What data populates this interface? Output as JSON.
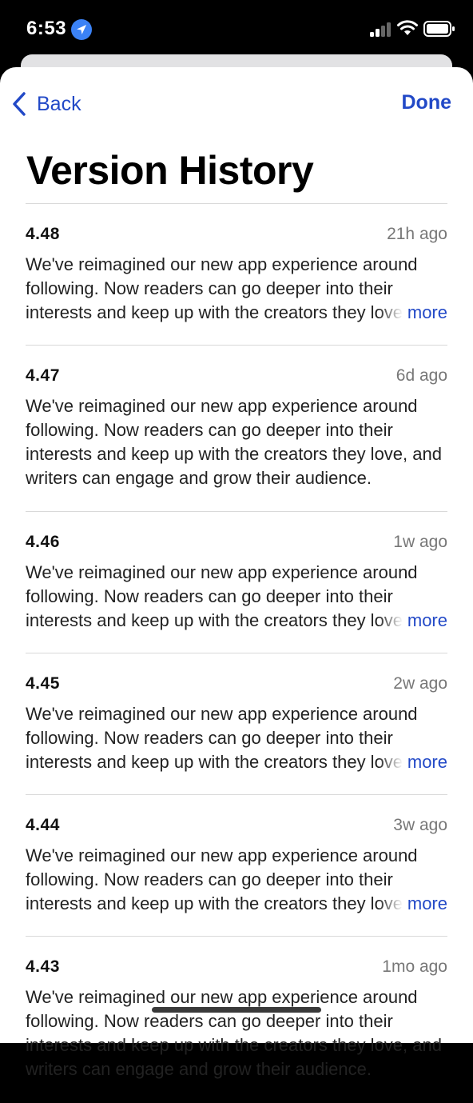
{
  "status_bar": {
    "time": "6:53",
    "icons": [
      "location-arrow-icon",
      "cellular-signal-icon",
      "wifi-icon",
      "battery-icon"
    ]
  },
  "nav": {
    "back_label": "Back",
    "done_label": "Done"
  },
  "page_title": "Version History",
  "colors": {
    "accent": "#2249c7",
    "location_badge": "#3b82f6",
    "secondary_text": "#777777",
    "divider": "#d9d9d9"
  },
  "versions": [
    {
      "number": "4.48",
      "date": "21h ago",
      "notes": "We've reimagined our new app experience around following. Now readers can go deeper into their interests and keep up with the creators they love, and writers can engage and grow their audience.",
      "more_label": "more"
    },
    {
      "number": "4.47",
      "date": "6d ago",
      "notes": "We've reimagined our new app experience around following. Now readers can go deeper into their interests and keep up with the creators they love, and writers can engage and grow their audience."
    },
    {
      "number": "4.46",
      "date": "1w ago",
      "notes": "We've reimagined our new app experience around following. Now readers can go deeper into their interests and keep up with the creators they love, and writers can engage and grow their audience.",
      "more_label": "more"
    },
    {
      "number": "4.45",
      "date": "2w ago",
      "notes": "We've reimagined our new app experience around following. Now readers can go deeper into their interests and keep up with the creators they love, and writers can engage and grow their audience.",
      "more_label": "more"
    },
    {
      "number": "4.44",
      "date": "3w ago",
      "notes": "We've reimagined our new app experience around following. Now readers can go deeper into their interests and keep up with the creators they love, and writers can engage and grow their audience.",
      "more_label": "more"
    },
    {
      "number": "4.43",
      "date": "1mo ago",
      "notes": "We've reimagined our new app experience around following. Now readers can go deeper into their interests and keep up with the creators they love, and writers can engage and grow their audience."
    }
  ]
}
